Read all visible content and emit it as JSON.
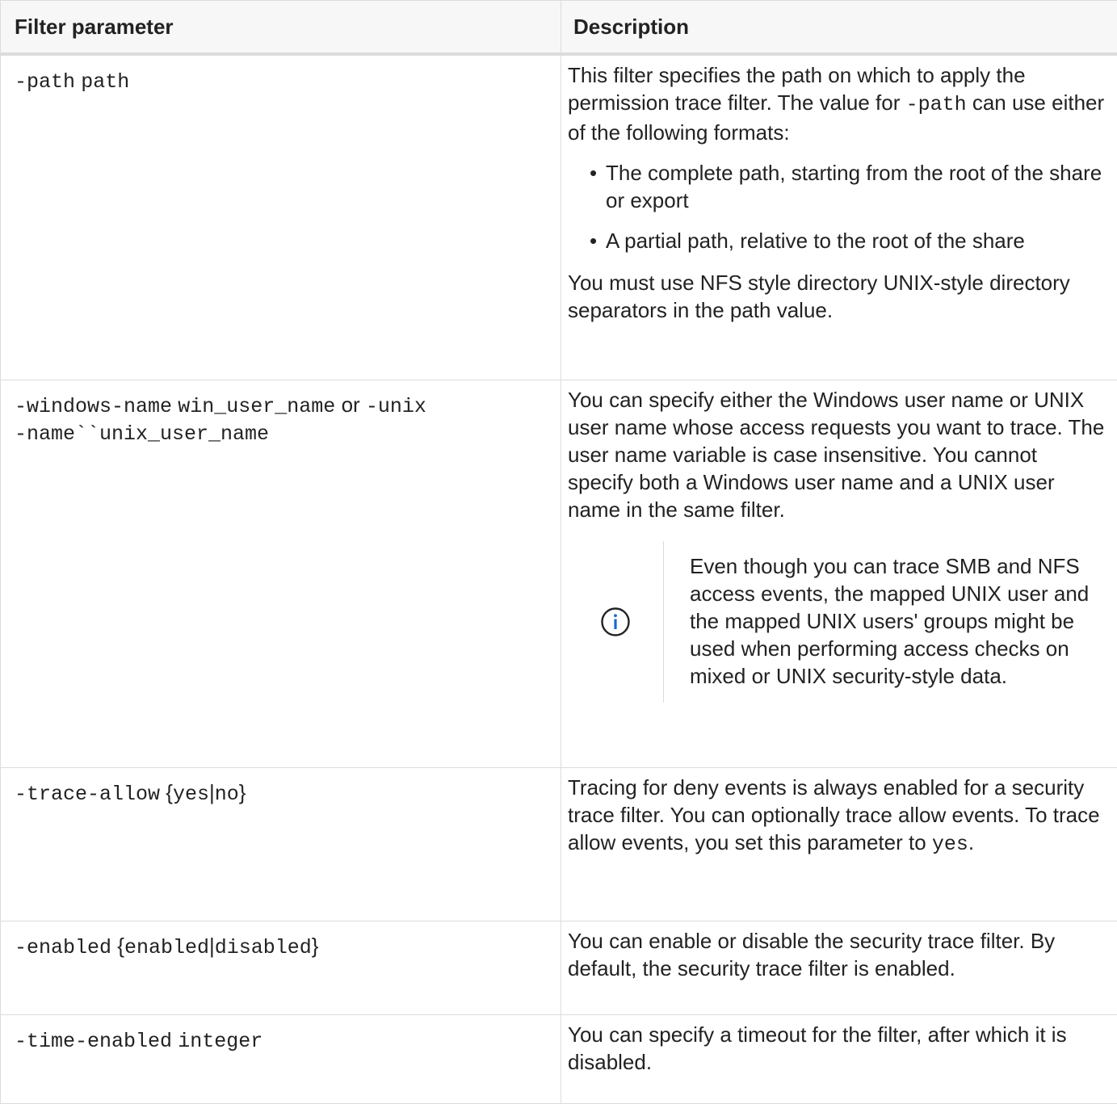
{
  "table": {
    "headers": {
      "param": "Filter parameter",
      "desc": "Description"
    },
    "rows": {
      "path": {
        "flag": "-path",
        "arg": "path",
        "desc_1": "This filter specifies the path on which to apply the permission trace filter. The value for ",
        "desc_code": "-path",
        "desc_2": " can use either of the following formats:",
        "bullets": [
          "The complete path, starting from the root of the share or export",
          "A partial path, relative to the root of the share"
        ],
        "desc_after": "You must use NFS style directory UNIX-style directory separators in the path value."
      },
      "name": {
        "flag1": "-windows-name",
        "arg1": "win_user_name",
        "or": "or",
        "flag2": "-unix",
        "line2": "-name``unix_user_name",
        "desc": "You can specify either the Windows user name or UNIX user name whose access requests you want to trace. The user name variable is case insensitive. You cannot specify both a Windows user name and a UNIX user name in the same filter.",
        "note_icon": "info-icon",
        "note": "Even though you can trace SMB and NFS access events, the mapped UNIX user and the mapped UNIX users' groups might be used when performing access checks on mixed or UNIX security-style data."
      },
      "allow": {
        "flag": "-trace-allow",
        "open": "{",
        "v1": "yes",
        "sep": "|",
        "v2": "no",
        "close": "}",
        "desc": "Tracing for deny events is always enabled for a security trace filter. You can optionally trace allow events. To trace allow events, you set this parameter to ",
        "desc_code": "yes",
        "desc_end": "."
      },
      "enabled": {
        "flag": "-enabled",
        "open": "{",
        "v1": "enabled",
        "sep": "|",
        "v2": "disabled",
        "close": "}",
        "desc": "You can enable or disable the security trace filter. By default, the security trace filter is enabled."
      },
      "time": {
        "flag": "-time-enabled",
        "arg": "integer",
        "desc": "You can specify a timeout for the filter, after which it is disabled."
      }
    }
  },
  "colors": {
    "text": "#222222",
    "border": "#dcdcdc",
    "header_bg": "#f7f7f8",
    "info_icon": "#1967d2"
  }
}
